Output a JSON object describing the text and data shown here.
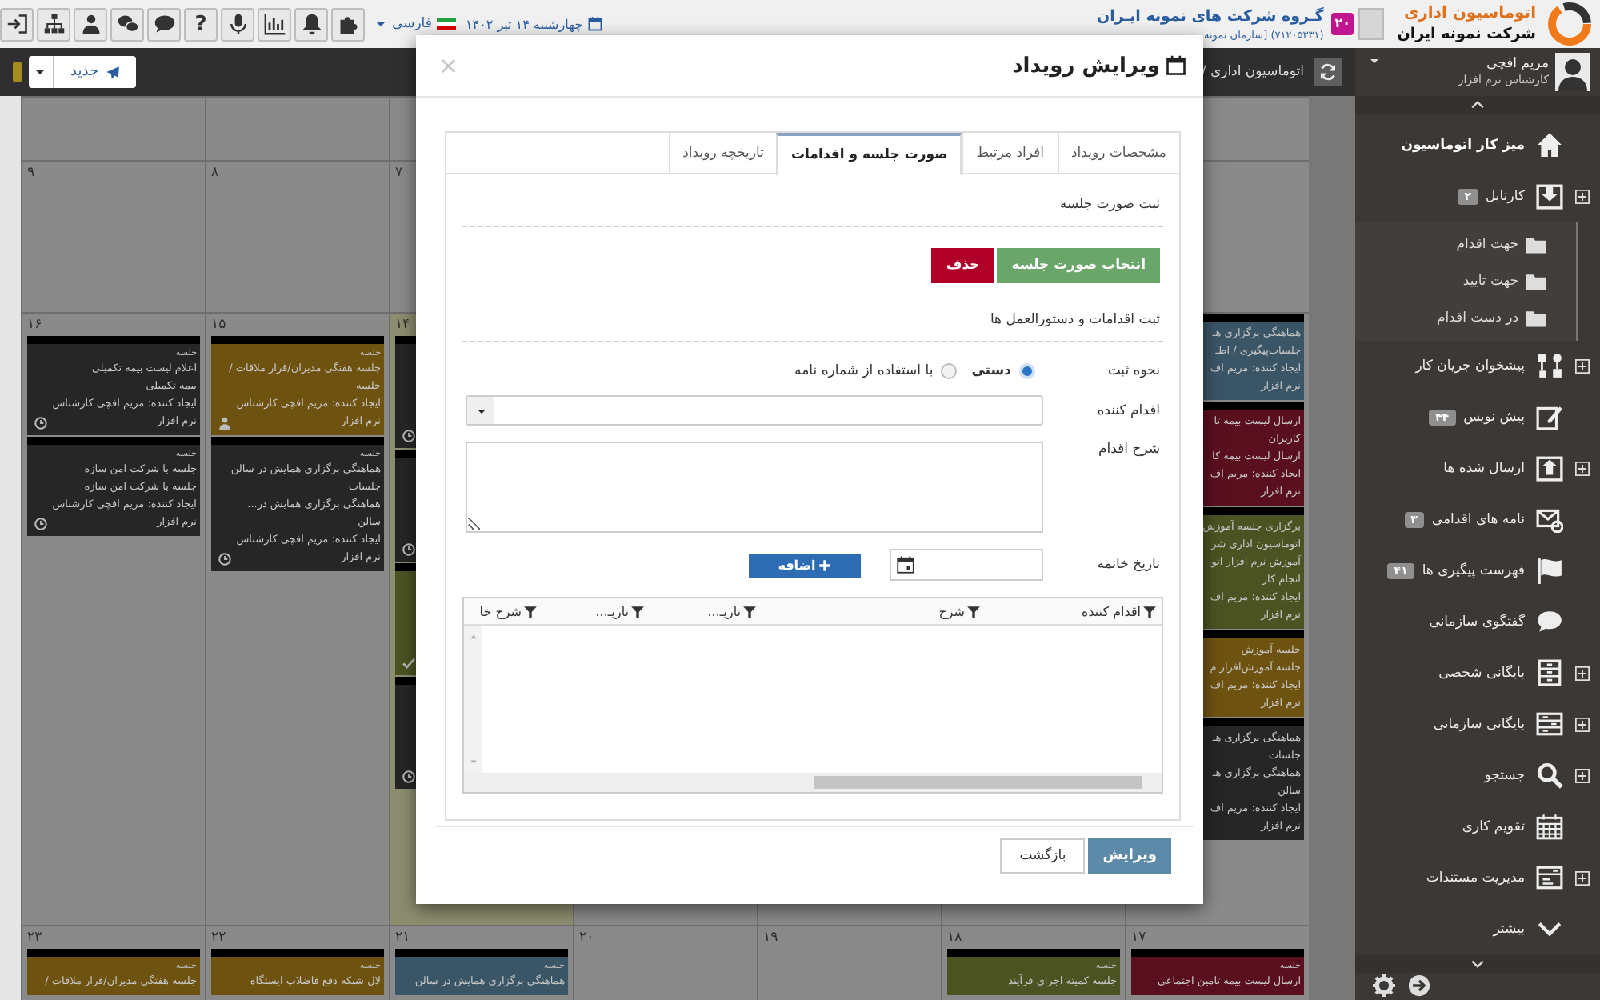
{
  "header": {
    "logo": {
      "title": "اتوماسیون اداری",
      "subtitle": "شرکت نمونه ایران"
    },
    "organization": {
      "name": "گـروه شرکت های نمونه ایـران",
      "badge": "۲۰",
      "details": "(۷۱۲۰۵۳۳۱) [سازمان نمونه"
    },
    "date": "چهارشنبه ۱۴ تیر ۱۴۰۲",
    "language": "فارسی",
    "help_button": "?"
  },
  "user": {
    "name": "مریم افچی",
    "role": "کارشناس نرم افزار"
  },
  "breadcrumb": "اتوماسیون اداری /",
  "new_button": "جدید",
  "sidebar": {
    "items": [
      {
        "label": "میز کار اتوماسیون",
        "selected": true,
        "expandable": false
      },
      {
        "label": "کارتابل",
        "badge": "۲",
        "selected": false,
        "expandable": true,
        "expanded": true,
        "children": [
          {
            "label": "جهت اقدام"
          },
          {
            "label": "جهت تایید"
          },
          {
            "label": "در دست اقدام"
          }
        ]
      },
      {
        "label": "پیشخوان جریان کار",
        "selected": false,
        "expandable": true
      },
      {
        "label": "پیش نویس",
        "badge": "۴۴",
        "selected": false,
        "expandable": false
      },
      {
        "label": "ارسال شده ها",
        "selected": false,
        "expandable": true
      },
      {
        "label": "نامه های اقدامی",
        "badge": "۳",
        "selected": false,
        "expandable": false
      },
      {
        "label": "فهرست پیگیری ها",
        "badge": "۴۱",
        "selected": false,
        "expandable": false
      },
      {
        "label": "گفتگوی سازمانی",
        "selected": false,
        "expandable": false
      },
      {
        "label": "بایگانی شخصی",
        "selected": false,
        "expandable": true
      },
      {
        "label": "بایگانی سازمانی",
        "selected": false,
        "expandable": true
      },
      {
        "label": "جستجو",
        "selected": false,
        "expandable": true
      },
      {
        "label": "تقویم کاری",
        "selected": false,
        "expandable": false
      },
      {
        "label": "مدیریت مستندات",
        "selected": false,
        "expandable": true
      },
      {
        "label": "بیشتر",
        "selected": false,
        "expandable": false
      }
    ]
  },
  "calendar": {
    "weeks": [
      {
        "days": [
          {
            "today": false
          },
          {
            "today": false
          },
          {
            "today": false
          },
          {
            "today": false
          }
        ]
      },
      {
        "days": [
          {
            "today": false
          },
          {
            "date": "۷",
            "today": false
          },
          {
            "date": "۸",
            "today": false
          },
          {
            "date": "۹",
            "today": false
          }
        ]
      },
      {
        "days": [
          {
            "today": false,
            "events": [
              {
                "color": "#3a5566",
                "lines": [
                  "هماهنگی برگزاری هـ",
                  "جلسات‌پیگیری / اطـ",
                  "ایجاد کننده: مریم اف",
                  "نرم افزار"
                ]
              },
              {
                "color": "#5a0f1f",
                "lines": [
                  "ارسال لیست بیمه تا",
                  "کاربران",
                  "ارسال لیست بیمه کا",
                  "ایجاد کننده: مریم اف",
                  "نرم افزار"
                ]
              },
              {
                "color": "#4b5322",
                "lines": [
                  "برگزاری جلسه آموزش",
                  "اتوماسیون اداری شر",
                  "آموزش نرم افزار اتو",
                  "انجام کار",
                  "ایجاد کننده: مریم اف",
                  "نرم افزار"
                ]
              },
              {
                "color": "#6e5210",
                "lines": [
                  "جلسه آموزش",
                  "جلسه آموزش‌افزار م",
                  "ایجاد کننده: مریم اف",
                  "نرم افزار"
                ]
              },
              {
                "color": "#262626",
                "lines": [
                  "هماهنگی برگزاری هـ",
                  "جلسات",
                  "هماهنگی برگزاری هـ",
                  "سالن",
                  "ایجاد کننده: مریم اف",
                  "نرم افزار"
                ]
              }
            ]
          },
          {
            "date": "۱۴",
            "today": true,
            "events": [
              {
                "color": "#262626",
                "kind": "clock"
              },
              {
                "color": "#262626",
                "kind": "clock"
              },
              {
                "color": "#4b5322",
                "kind": "check"
              },
              {
                "color": "#262626",
                "kind": "clock"
              }
            ]
          },
          {
            "date": "۱۵",
            "today": false,
            "events": [
              {
                "color": "#6e5210",
                "kind": "person",
                "label": "جلسه",
                "lines": [
                  "جلسه هفتگی مدیران/قرار ملاقات /",
                  "جلسه",
                  "ایجاد کننده: مریم افچی کارشناس",
                  "نرم افزار"
                ]
              },
              {
                "color": "#262626",
                "kind": "clock",
                "label": "جلسه",
                "lines": [
                  "هماهنگی برگزاری همایش در سالن",
                  "جلسات",
                  "هماهنگی برگزاری همایش در...",
                  "سالن",
                  "ایجاد کننده: مریم افچی کارشناس",
                  "نرم افزار"
                ]
              }
            ]
          },
          {
            "date": "۱۶",
            "today": false,
            "events": [
              {
                "color": "#262626",
                "kind": "clock",
                "label": "جلسه",
                "lines": [
                  "اعلام لیست بیمه تکمیلی",
                  "بیمه تکمیلی",
                  "ایجاد کننده: مریم افچی کارشناس",
                  "نرم افزار"
                ]
              },
              {
                "color": "#262626",
                "kind": "clock",
                "label": "جلسه",
                "lines": [
                  "جلسه با شرکت امن سازه",
                  "جلسه با شرکت امن سازه",
                  "ایجاد کننده: مریم افچی کارشناس",
                  "نرم افزار"
                ]
              }
            ]
          }
        ]
      },
      {
        "days": [
          {
            "date": "۱۷",
            "today": false,
            "events": [
              {
                "color": "#5a0f1f",
                "label": "جلسه",
                "lines": [
                  "ارسال لیست بیمه تامین اجتماعی"
                ]
              }
            ]
          },
          {
            "date": "۱۸",
            "today": false,
            "events": [
              {
                "color": "#4b5322",
                "label": "جلسه",
                "lines": [
                  "جلسه کمیته اجرای فرآیند"
                ]
              }
            ]
          },
          {
            "date": "۱۹",
            "today": false
          },
          {
            "date": "۲۰",
            "today": false
          },
          {
            "date": "۲۱",
            "today": false,
            "events": [
              {
                "color": "#3a5566",
                "label": "جلسه",
                "lines": [
                  "هماهنگی برگزاری همایش در سالن"
                ]
              }
            ]
          },
          {
            "date": "۲۲",
            "today": false,
            "events": [
              {
                "color": "#6e5210",
                "label": "جلسه",
                "lines": [
                  "لال شبکه دفع فاضلاب ایستگاه"
                ]
              }
            ]
          },
          {
            "date": "۲۳",
            "today": false,
            "events": [
              {
                "color": "#6e5210",
                "label": "جلسه",
                "lines": [
                  "جلسه هفتگی مدیران/قرار ملاقات /"
                ]
              }
            ]
          }
        ]
      }
    ]
  },
  "dialog": {
    "title": "ویرایش رویداد",
    "close": "×",
    "tabs": [
      {
        "label": "مشخصات رویداد",
        "selected": false
      },
      {
        "label": "افراد مرتبط",
        "selected": false
      },
      {
        "label": "صورت جلسه و اقدامات",
        "selected": true
      },
      {
        "label": "تاریخچه رویداد",
        "selected": false
      }
    ],
    "minutes_section": "ثبت صورت جلسه",
    "select_button": "انتخاب صورت جلسه",
    "delete_button": "حذف",
    "actions_section": "ثبت اقدامات و دستورالعمل ها",
    "method": {
      "label": "نحوه ثبت",
      "options": [
        {
          "label": "دستی",
          "selected": true
        },
        {
          "label": "با استفاده از شماره نامه",
          "selected": false
        }
      ]
    },
    "actor": {
      "label": "اقدام کننده"
    },
    "description": {
      "label": "شرح اقدام"
    },
    "end_date": {
      "label": "تاریخ خاتمه"
    },
    "add_button": "اضافه",
    "grid": {
      "columns": [
        "اقدام کننده",
        "شرح",
        "تاریـ...",
        "تاریـ...",
        "شرح خا"
      ]
    },
    "buttons": [
      {
        "label": "ویرایش",
        "kind": "primary"
      },
      {
        "label": "بازگشت",
        "kind": "default"
      }
    ]
  }
}
